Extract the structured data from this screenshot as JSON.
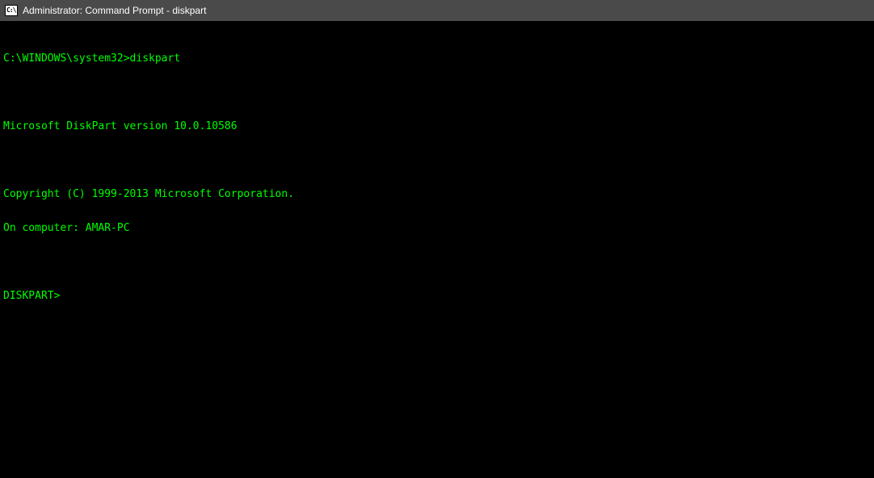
{
  "titlebar": {
    "icon_text": "C:\\",
    "title": "Administrator: Command Prompt - diskpart"
  },
  "terminal": {
    "prompt_path": "C:\\WINDOWS\\system32>",
    "command": "diskpart",
    "version_line": "Microsoft DiskPart version 10.0.10586",
    "copyright_line": "Copyright (C) 1999-2013 Microsoft Corporation.",
    "computer_line": "On computer: AMAR-PC",
    "diskpart_prompt": "DISKPART>"
  }
}
